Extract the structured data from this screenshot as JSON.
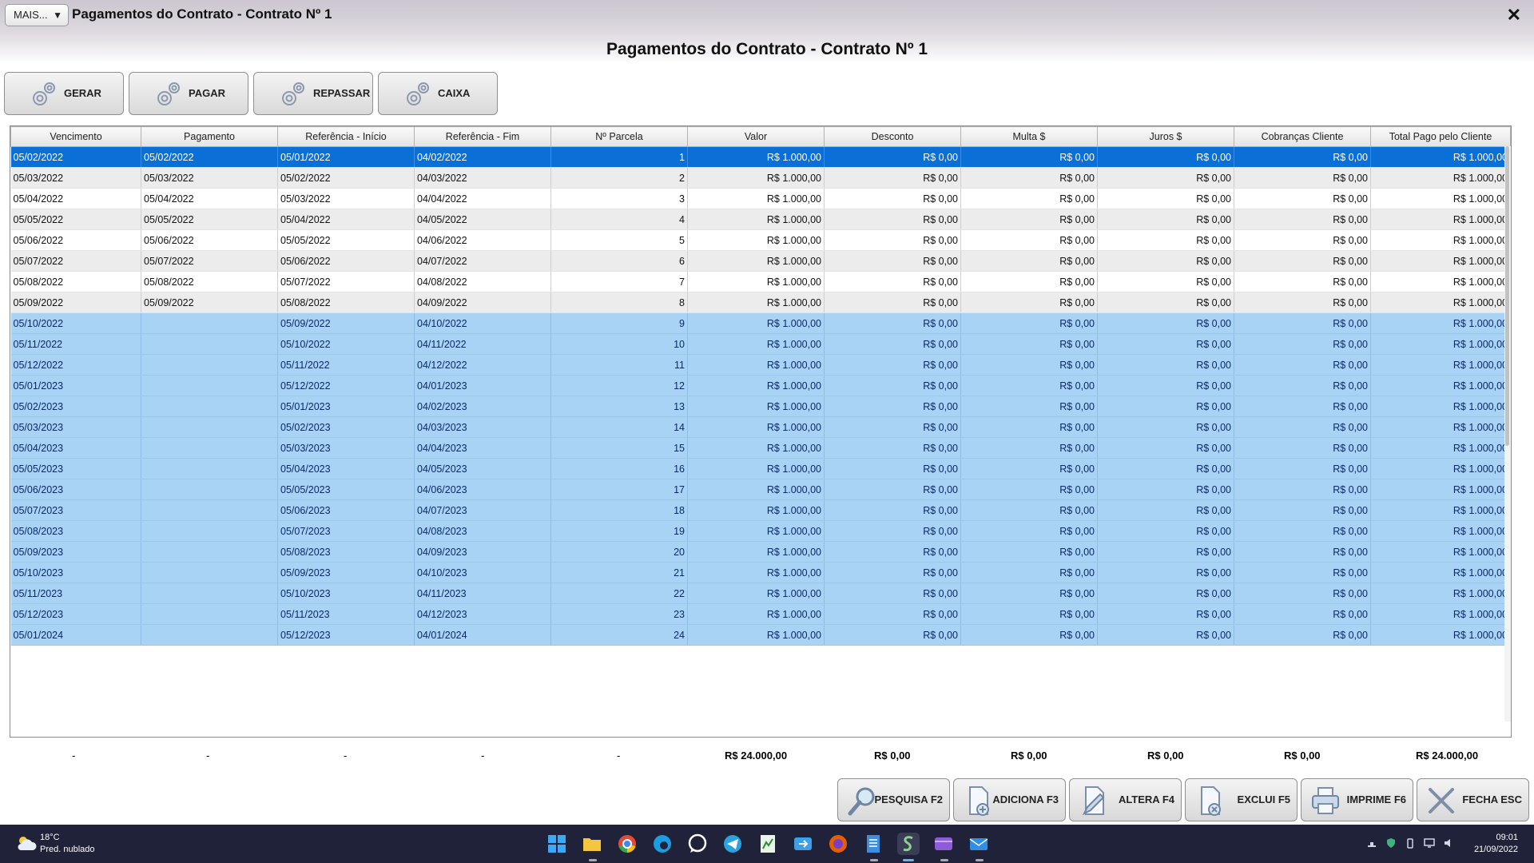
{
  "window": {
    "menu_label": "MAIS...",
    "title": "Pagamentos do Contrato - Contrato Nº 1",
    "close_glyph": "✕"
  },
  "page_title": "Pagamentos do Contrato - Contrato Nº 1",
  "actions": [
    {
      "label": "GERAR",
      "icon": "gear-icon"
    },
    {
      "label": "PAGAR",
      "icon": "gear-icon"
    },
    {
      "label": "REPASSAR",
      "icon": "gear-icon"
    },
    {
      "label": "CAIXA",
      "icon": "gear-icon"
    }
  ],
  "table": {
    "columns": [
      "Vencimento",
      "Pagamento",
      "Referência - Início",
      "Referência - Fim",
      "Nº Parcela",
      "Valor",
      "Desconto",
      "Multa $",
      "Juros $",
      "Cobranças Cliente",
      "Total Pago pelo Cliente"
    ],
    "rows": [
      {
        "status": "selected",
        "cells": [
          "05/02/2022",
          "05/02/2022",
          "05/01/2022",
          "04/02/2022",
          "1",
          "R$ 1.000,00",
          "R$ 0,00",
          "R$ 0,00",
          "R$ 0,00",
          "R$ 0,00",
          "R$ 1.000,00"
        ]
      },
      {
        "status": "paid",
        "cells": [
          "05/03/2022",
          "05/03/2022",
          "05/02/2022",
          "04/03/2022",
          "2",
          "R$ 1.000,00",
          "R$ 0,00",
          "R$ 0,00",
          "R$ 0,00",
          "R$ 0,00",
          "R$ 1.000,00"
        ]
      },
      {
        "status": "paid",
        "cells": [
          "05/04/2022",
          "05/04/2022",
          "05/03/2022",
          "04/04/2022",
          "3",
          "R$ 1.000,00",
          "R$ 0,00",
          "R$ 0,00",
          "R$ 0,00",
          "R$ 0,00",
          "R$ 1.000,00"
        ]
      },
      {
        "status": "paid",
        "cells": [
          "05/05/2022",
          "05/05/2022",
          "05/04/2022",
          "04/05/2022",
          "4",
          "R$ 1.000,00",
          "R$ 0,00",
          "R$ 0,00",
          "R$ 0,00",
          "R$ 0,00",
          "R$ 1.000,00"
        ]
      },
      {
        "status": "paid",
        "cells": [
          "05/06/2022",
          "05/06/2022",
          "05/05/2022",
          "04/06/2022",
          "5",
          "R$ 1.000,00",
          "R$ 0,00",
          "R$ 0,00",
          "R$ 0,00",
          "R$ 0,00",
          "R$ 1.000,00"
        ]
      },
      {
        "status": "paid",
        "cells": [
          "05/07/2022",
          "05/07/2022",
          "05/06/2022",
          "04/07/2022",
          "6",
          "R$ 1.000,00",
          "R$ 0,00",
          "R$ 0,00",
          "R$ 0,00",
          "R$ 0,00",
          "R$ 1.000,00"
        ]
      },
      {
        "status": "paid",
        "cells": [
          "05/08/2022",
          "05/08/2022",
          "05/07/2022",
          "04/08/2022",
          "7",
          "R$ 1.000,00",
          "R$ 0,00",
          "R$ 0,00",
          "R$ 0,00",
          "R$ 0,00",
          "R$ 1.000,00"
        ]
      },
      {
        "status": "paid",
        "cells": [
          "05/09/2022",
          "05/09/2022",
          "05/08/2022",
          "04/09/2022",
          "8",
          "R$ 1.000,00",
          "R$ 0,00",
          "R$ 0,00",
          "R$ 0,00",
          "R$ 0,00",
          "R$ 1.000,00"
        ]
      },
      {
        "status": "pending",
        "cells": [
          "05/10/2022",
          "",
          "05/09/2022",
          "04/10/2022",
          "9",
          "R$ 1.000,00",
          "R$ 0,00",
          "R$ 0,00",
          "R$ 0,00",
          "R$ 0,00",
          "R$ 1.000,00"
        ]
      },
      {
        "status": "pending",
        "cells": [
          "05/11/2022",
          "",
          "05/10/2022",
          "04/11/2022",
          "10",
          "R$ 1.000,00",
          "R$ 0,00",
          "R$ 0,00",
          "R$ 0,00",
          "R$ 0,00",
          "R$ 1.000,00"
        ]
      },
      {
        "status": "pending",
        "cells": [
          "05/12/2022",
          "",
          "05/11/2022",
          "04/12/2022",
          "11",
          "R$ 1.000,00",
          "R$ 0,00",
          "R$ 0,00",
          "R$ 0,00",
          "R$ 0,00",
          "R$ 1.000,00"
        ]
      },
      {
        "status": "pending",
        "cells": [
          "05/01/2023",
          "",
          "05/12/2022",
          "04/01/2023",
          "12",
          "R$ 1.000,00",
          "R$ 0,00",
          "R$ 0,00",
          "R$ 0,00",
          "R$ 0,00",
          "R$ 1.000,00"
        ]
      },
      {
        "status": "pending",
        "cells": [
          "05/02/2023",
          "",
          "05/01/2023",
          "04/02/2023",
          "13",
          "R$ 1.000,00",
          "R$ 0,00",
          "R$ 0,00",
          "R$ 0,00",
          "R$ 0,00",
          "R$ 1.000,00"
        ]
      },
      {
        "status": "pending",
        "cells": [
          "05/03/2023",
          "",
          "05/02/2023",
          "04/03/2023",
          "14",
          "R$ 1.000,00",
          "R$ 0,00",
          "R$ 0,00",
          "R$ 0,00",
          "R$ 0,00",
          "R$ 1.000,00"
        ]
      },
      {
        "status": "pending",
        "cells": [
          "05/04/2023",
          "",
          "05/03/2023",
          "04/04/2023",
          "15",
          "R$ 1.000,00",
          "R$ 0,00",
          "R$ 0,00",
          "R$ 0,00",
          "R$ 0,00",
          "R$ 1.000,00"
        ]
      },
      {
        "status": "pending",
        "cells": [
          "05/05/2023",
          "",
          "05/04/2023",
          "04/05/2023",
          "16",
          "R$ 1.000,00",
          "R$ 0,00",
          "R$ 0,00",
          "R$ 0,00",
          "R$ 0,00",
          "R$ 1.000,00"
        ]
      },
      {
        "status": "pending",
        "cells": [
          "05/06/2023",
          "",
          "05/05/2023",
          "04/06/2023",
          "17",
          "R$ 1.000,00",
          "R$ 0,00",
          "R$ 0,00",
          "R$ 0,00",
          "R$ 0,00",
          "R$ 1.000,00"
        ]
      },
      {
        "status": "pending",
        "cells": [
          "05/07/2023",
          "",
          "05/06/2023",
          "04/07/2023",
          "18",
          "R$ 1.000,00",
          "R$ 0,00",
          "R$ 0,00",
          "R$ 0,00",
          "R$ 0,00",
          "R$ 1.000,00"
        ]
      },
      {
        "status": "pending",
        "cells": [
          "05/08/2023",
          "",
          "05/07/2023",
          "04/08/2023",
          "19",
          "R$ 1.000,00",
          "R$ 0,00",
          "R$ 0,00",
          "R$ 0,00",
          "R$ 0,00",
          "R$ 1.000,00"
        ]
      },
      {
        "status": "pending",
        "cells": [
          "05/09/2023",
          "",
          "05/08/2023",
          "04/09/2023",
          "20",
          "R$ 1.000,00",
          "R$ 0,00",
          "R$ 0,00",
          "R$ 0,00",
          "R$ 0,00",
          "R$ 1.000,00"
        ]
      },
      {
        "status": "pending",
        "cells": [
          "05/10/2023",
          "",
          "05/09/2023",
          "04/10/2023",
          "21",
          "R$ 1.000,00",
          "R$ 0,00",
          "R$ 0,00",
          "R$ 0,00",
          "R$ 0,00",
          "R$ 1.000,00"
        ]
      },
      {
        "status": "pending",
        "cells": [
          "05/11/2023",
          "",
          "05/10/2023",
          "04/11/2023",
          "22",
          "R$ 1.000,00",
          "R$ 0,00",
          "R$ 0,00",
          "R$ 0,00",
          "R$ 0,00",
          "R$ 1.000,00"
        ]
      },
      {
        "status": "pending",
        "cells": [
          "05/12/2023",
          "",
          "05/11/2023",
          "04/12/2023",
          "23",
          "R$ 1.000,00",
          "R$ 0,00",
          "R$ 0,00",
          "R$ 0,00",
          "R$ 0,00",
          "R$ 1.000,00"
        ]
      },
      {
        "status": "pending",
        "cells": [
          "05/01/2024",
          "",
          "05/12/2023",
          "04/01/2024",
          "24",
          "R$ 1.000,00",
          "R$ 0,00",
          "R$ 0,00",
          "R$ 0,00",
          "R$ 0,00",
          "R$ 1.000,00"
        ]
      }
    ]
  },
  "totals": [
    "-",
    "-",
    "-",
    "-",
    "-",
    "R$ 24.000,00",
    "R$ 0,00",
    "R$ 0,00",
    "R$ 0,00",
    "R$ 0,00",
    "R$ 24.000,00"
  ],
  "bottom_actions": [
    {
      "label": "PESQUISA F2",
      "icon": "magnifier-icon"
    },
    {
      "label": "ADICIONA F3",
      "icon": "add-document-icon"
    },
    {
      "label": "ALTERA F4",
      "icon": "edit-document-icon"
    },
    {
      "label": "EXCLUI F5",
      "icon": "delete-document-icon"
    },
    {
      "label": "IMPRIME F6",
      "icon": "printer-icon"
    },
    {
      "label": "FECHA ESC",
      "icon": "close-icon"
    }
  ],
  "taskbar": {
    "weather_temp": "18°C",
    "weather_desc": "Pred. nublado",
    "time": "09:01",
    "date": "21/09/2022",
    "apps": [
      "windows-start-icon",
      "file-explorer-icon",
      "chrome-icon",
      "edge-icon",
      "whatsapp-icon",
      "telegram-icon",
      "spreadsheet-icon",
      "remote-desktop-icon",
      "firefox-icon",
      "notes-icon",
      "app-s-icon",
      "media-icon",
      "mail-icon"
    ]
  },
  "colors": {
    "selected_row": "#0a6fd6",
    "pending_row": "#a9d3f5",
    "taskbar": "#1f2238"
  }
}
